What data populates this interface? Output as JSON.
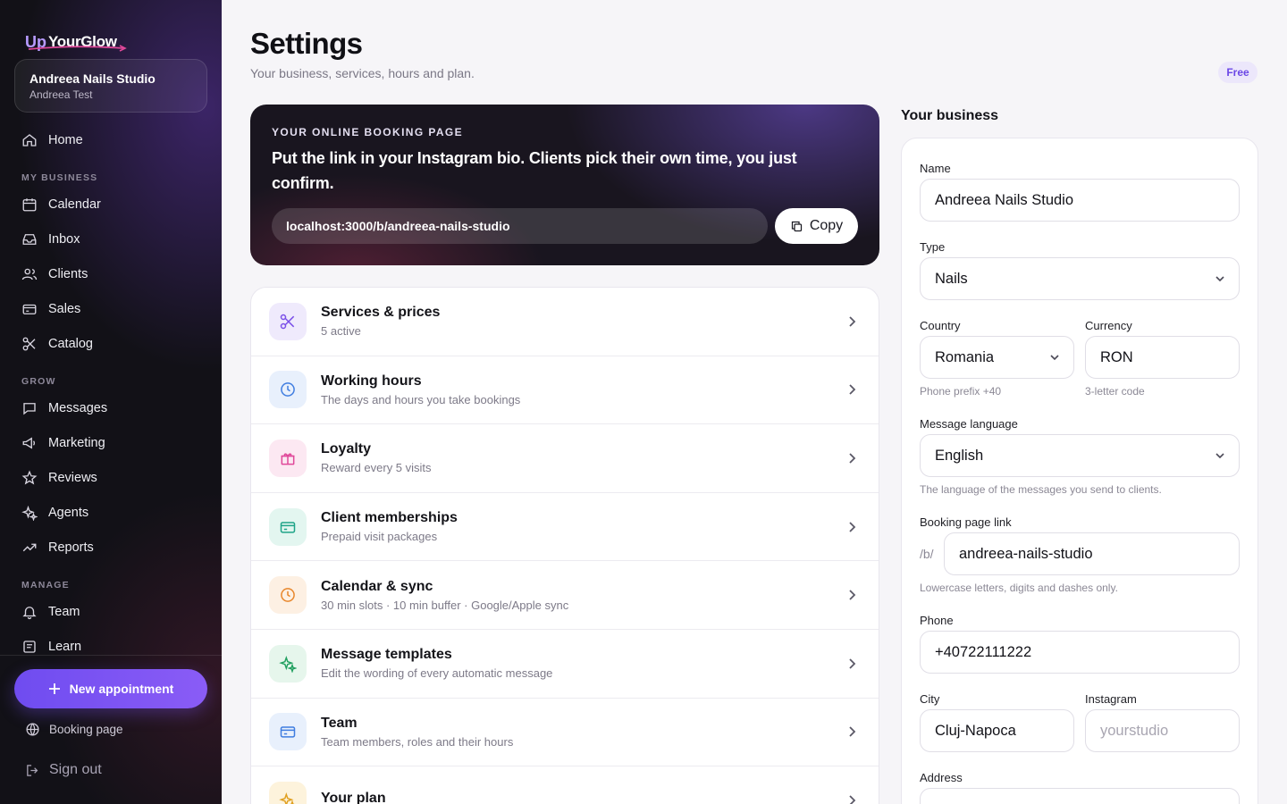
{
  "brand": {
    "up": "Up",
    "name": "YourGlow"
  },
  "business_card": {
    "name": "Andreea Nails Studio",
    "owner": "Andreea Test"
  },
  "nav": {
    "home": "Home",
    "sections": {
      "my_business": "MY BUSINESS",
      "grow": "GROW",
      "manage": "MANAGE"
    },
    "my_business": [
      "Calendar",
      "Inbox",
      "Clients",
      "Sales",
      "Catalog"
    ],
    "grow": [
      "Messages",
      "Marketing",
      "Reviews",
      "Agents",
      "Reports"
    ],
    "manage": [
      "Team",
      "Learn"
    ]
  },
  "sidebar_actions": {
    "new_appointment": "New appointment",
    "booking_page": "Booking page",
    "sign_out": "Sign out"
  },
  "header": {
    "title": "Settings",
    "subtitle": "Your business, services, hours and plan.",
    "plan": "Free"
  },
  "booking": {
    "eyebrow": "YOUR ONLINE BOOKING PAGE",
    "headline": "Put the link in your Instagram bio. Clients pick their own time, you just confirm.",
    "url": "localhost:3000/b/andreea-nails-studio",
    "copy_label": "Copy"
  },
  "settings_rows": [
    {
      "title": "Services & prices",
      "subtitle": "5 active",
      "icon": "scissors-icon",
      "color": "#7a4fe8",
      "bg": "#efeafc"
    },
    {
      "title": "Working hours",
      "subtitle": "The days and hours you take bookings",
      "icon": "clock-icon",
      "color": "#3f7de0",
      "bg": "#e8f0fc"
    },
    {
      "title": "Loyalty",
      "subtitle": "Reward every 5 visits",
      "icon": "gift-icon",
      "color": "#e0489a",
      "bg": "#fce8f2"
    },
    {
      "title": "Client memberships",
      "subtitle": "Prepaid visit packages",
      "icon": "card-icon",
      "color": "#1fa488",
      "bg": "#e3f6f0"
    },
    {
      "title": "Calendar & sync",
      "subtitle": "30 min slots · 10 min buffer · Google/Apple sync",
      "icon": "clock-icon",
      "color": "#e8862a",
      "bg": "#fdf0e3"
    },
    {
      "title": "Message templates",
      "subtitle": "Edit the wording of every automatic message",
      "icon": "sparkles-icon",
      "color": "#22a060",
      "bg": "#e6f6ec"
    },
    {
      "title": "Team",
      "subtitle": "Team members, roles and their hours",
      "icon": "card-icon",
      "color": "#3f7de0",
      "bg": "#e8f0fc"
    },
    {
      "title": "Your plan",
      "subtitle": "",
      "icon": "sparkles-icon",
      "color": "#e0a020",
      "bg": "#fdf3dc"
    }
  ],
  "business_form": {
    "section_title": "Your business",
    "name_label": "Name",
    "name_value": "Andreea Nails Studio",
    "type_label": "Type",
    "type_value": "Nails",
    "country_label": "Country",
    "country_value": "Romania",
    "country_hint": "Phone prefix +40",
    "currency_label": "Currency",
    "currency_value": "RON",
    "currency_hint": "3-letter code",
    "language_label": "Message language",
    "language_value": "English",
    "language_hint": "The language of the messages you send to clients.",
    "link_label": "Booking page link",
    "link_prefix": "/b/",
    "link_value": "andreea-nails-studio",
    "link_hint": "Lowercase letters, digits and dashes only.",
    "phone_label": "Phone",
    "phone_value": "+40722111222",
    "city_label": "City",
    "city_value": "Cluj-Napoca",
    "instagram_label": "Instagram",
    "instagram_placeholder": "yourstudio",
    "address_label": "Address"
  }
}
